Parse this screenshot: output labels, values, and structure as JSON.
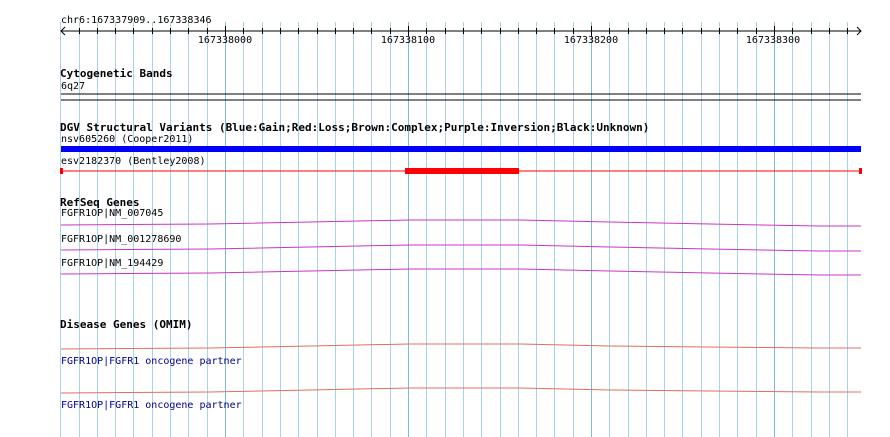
{
  "ruler": {
    "region": "chr6:167337909..167338346",
    "ticks": [
      "167338000",
      "167338100",
      "167338200",
      "167338300"
    ]
  },
  "tracks": {
    "cytobands": {
      "title": "Cytogenetic Bands",
      "band": "6q27"
    },
    "dgv": {
      "title": "DGV Structural Variants (Blue:Gain;Red:Loss;Brown:Complex;Purple:Inversion;Black:Unknown)",
      "features": [
        {
          "label": "nsv605260 (Cooper2011)",
          "color": "#0000ff"
        },
        {
          "label": "esv2182370 (Bentley2008)",
          "color": "#ff0000"
        }
      ]
    },
    "refseq": {
      "title": "RefSeq Genes",
      "genes": [
        {
          "label": "FGFR1OP|NM_007045",
          "color": "#cc33cc"
        },
        {
          "label": "FGFR1OP|NM_001278690",
          "color": "#cc33cc"
        },
        {
          "label": "FGFR1OP|NM_194429",
          "color": "#cc33cc"
        }
      ]
    },
    "omim": {
      "title": "Disease Genes (OMIM)",
      "genes": [
        {
          "label": "FGFR1OP|FGFR1 oncogene partner",
          "color": "#e0705c"
        },
        {
          "label": "FGFR1OP|FGFR1 oncogene partner",
          "color": "#e0705c"
        }
      ]
    }
  },
  "colors": {
    "grid": "#a8d4e8",
    "grid_major": "#7fbcd8"
  }
}
